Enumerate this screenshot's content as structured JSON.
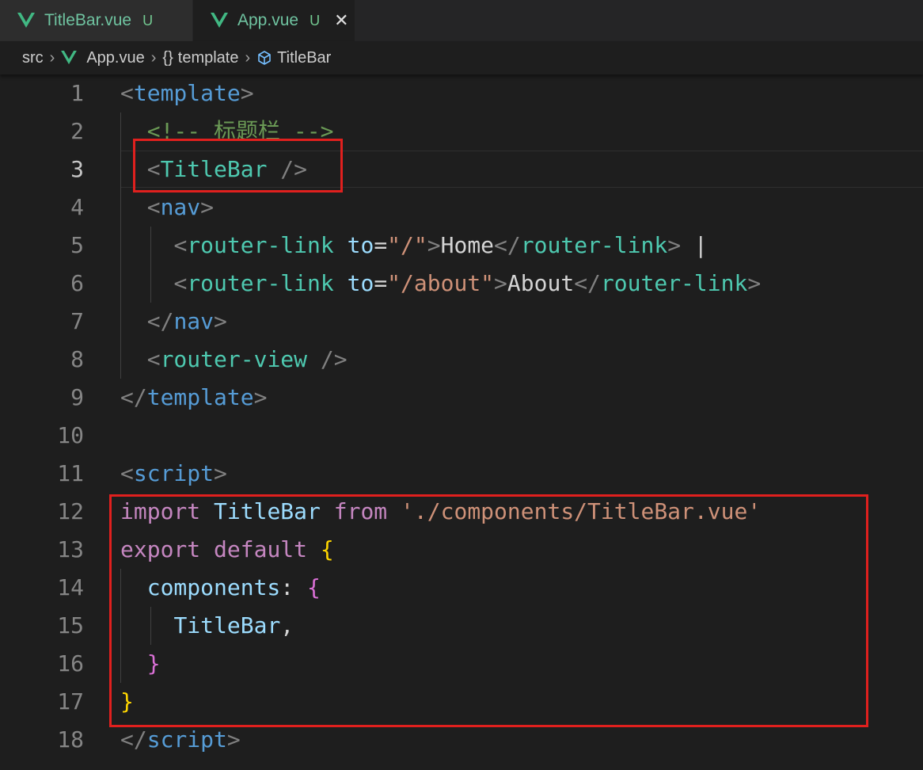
{
  "tabs": [
    {
      "name": "TitleBar.vue",
      "status": "U",
      "active": false
    },
    {
      "name": "App.vue",
      "status": "U",
      "active": true,
      "close": "✕"
    }
  ],
  "breadcrumb": {
    "folder": "src",
    "file": "App.vue",
    "section_brace": "{}",
    "section": "template",
    "component": "TitleBar"
  },
  "colors": {
    "vue_logo": "#41b883",
    "highlight_box": "#e0201e",
    "editor_background": "#1e1e1e"
  },
  "editor": {
    "current_line": 3,
    "lines": [
      {
        "num": "1",
        "tokens": [
          [
            "p",
            "<"
          ],
          [
            "t",
            "template"
          ],
          [
            "p",
            ">"
          ]
        ]
      },
      {
        "num": "2",
        "tokens": [
          [
            "w",
            "  "
          ],
          [
            "m",
            "<!-- 标题栏 -->"
          ]
        ]
      },
      {
        "num": "3",
        "tokens": [
          [
            "w",
            "  "
          ],
          [
            "p",
            "<"
          ],
          [
            "c",
            "TitleBar"
          ],
          [
            "w",
            " "
          ],
          [
            "p",
            "/>"
          ]
        ]
      },
      {
        "num": "4",
        "tokens": [
          [
            "w",
            "  "
          ],
          [
            "p",
            "<"
          ],
          [
            "t",
            "nav"
          ],
          [
            "p",
            ">"
          ]
        ]
      },
      {
        "num": "5",
        "tokens": [
          [
            "w",
            "    "
          ],
          [
            "p",
            "<"
          ],
          [
            "c",
            "router-link"
          ],
          [
            "w",
            " "
          ],
          [
            "a",
            "to"
          ],
          [
            "w",
            "="
          ],
          [
            "s",
            "\"/\""
          ],
          [
            "p",
            ">"
          ],
          [
            "w",
            "Home"
          ],
          [
            "p",
            "</"
          ],
          [
            "c",
            "router-link"
          ],
          [
            "p",
            ">"
          ],
          [
            "w",
            " |"
          ]
        ]
      },
      {
        "num": "6",
        "tokens": [
          [
            "w",
            "    "
          ],
          [
            "p",
            "<"
          ],
          [
            "c",
            "router-link"
          ],
          [
            "w",
            " "
          ],
          [
            "a",
            "to"
          ],
          [
            "w",
            "="
          ],
          [
            "s",
            "\"/about\""
          ],
          [
            "p",
            ">"
          ],
          [
            "w",
            "About"
          ],
          [
            "p",
            "</"
          ],
          [
            "c",
            "router-link"
          ],
          [
            "p",
            ">"
          ]
        ]
      },
      {
        "num": "7",
        "tokens": [
          [
            "w",
            "  "
          ],
          [
            "p",
            "</"
          ],
          [
            "t",
            "nav"
          ],
          [
            "p",
            ">"
          ]
        ]
      },
      {
        "num": "8",
        "tokens": [
          [
            "w",
            "  "
          ],
          [
            "p",
            "<"
          ],
          [
            "c",
            "router-view"
          ],
          [
            "w",
            " "
          ],
          [
            "p",
            "/>"
          ]
        ]
      },
      {
        "num": "9",
        "tokens": [
          [
            "p",
            "</"
          ],
          [
            "t",
            "template"
          ],
          [
            "p",
            ">"
          ]
        ]
      },
      {
        "num": "10",
        "tokens": []
      },
      {
        "num": "11",
        "tokens": [
          [
            "p",
            "<"
          ],
          [
            "t",
            "script"
          ],
          [
            "p",
            ">"
          ]
        ]
      },
      {
        "num": "12",
        "tokens": [
          [
            "k",
            "import"
          ],
          [
            "w",
            " "
          ],
          [
            "v",
            "TitleBar"
          ],
          [
            "w",
            " "
          ],
          [
            "k",
            "from"
          ],
          [
            "w",
            " "
          ],
          [
            "s",
            "'./components/TitleBar.vue'"
          ]
        ]
      },
      {
        "num": "13",
        "tokens": [
          [
            "k",
            "export"
          ],
          [
            "w",
            " "
          ],
          [
            "k",
            "default"
          ],
          [
            "w",
            " "
          ],
          [
            "b1",
            "{"
          ]
        ]
      },
      {
        "num": "14",
        "tokens": [
          [
            "w",
            "  "
          ],
          [
            "v",
            "components"
          ],
          [
            "w",
            ": "
          ],
          [
            "b2",
            "{"
          ]
        ]
      },
      {
        "num": "15",
        "tokens": [
          [
            "w",
            "    "
          ],
          [
            "v",
            "TitleBar"
          ],
          [
            "w",
            ","
          ]
        ]
      },
      {
        "num": "16",
        "tokens": [
          [
            "w",
            "  "
          ],
          [
            "b2",
            "}"
          ]
        ]
      },
      {
        "num": "17",
        "tokens": [
          [
            "b1",
            "}"
          ]
        ]
      },
      {
        "num": "18",
        "tokens": [
          [
            "p",
            "</"
          ],
          [
            "t",
            "script"
          ],
          [
            "p",
            ">"
          ]
        ]
      }
    ]
  }
}
